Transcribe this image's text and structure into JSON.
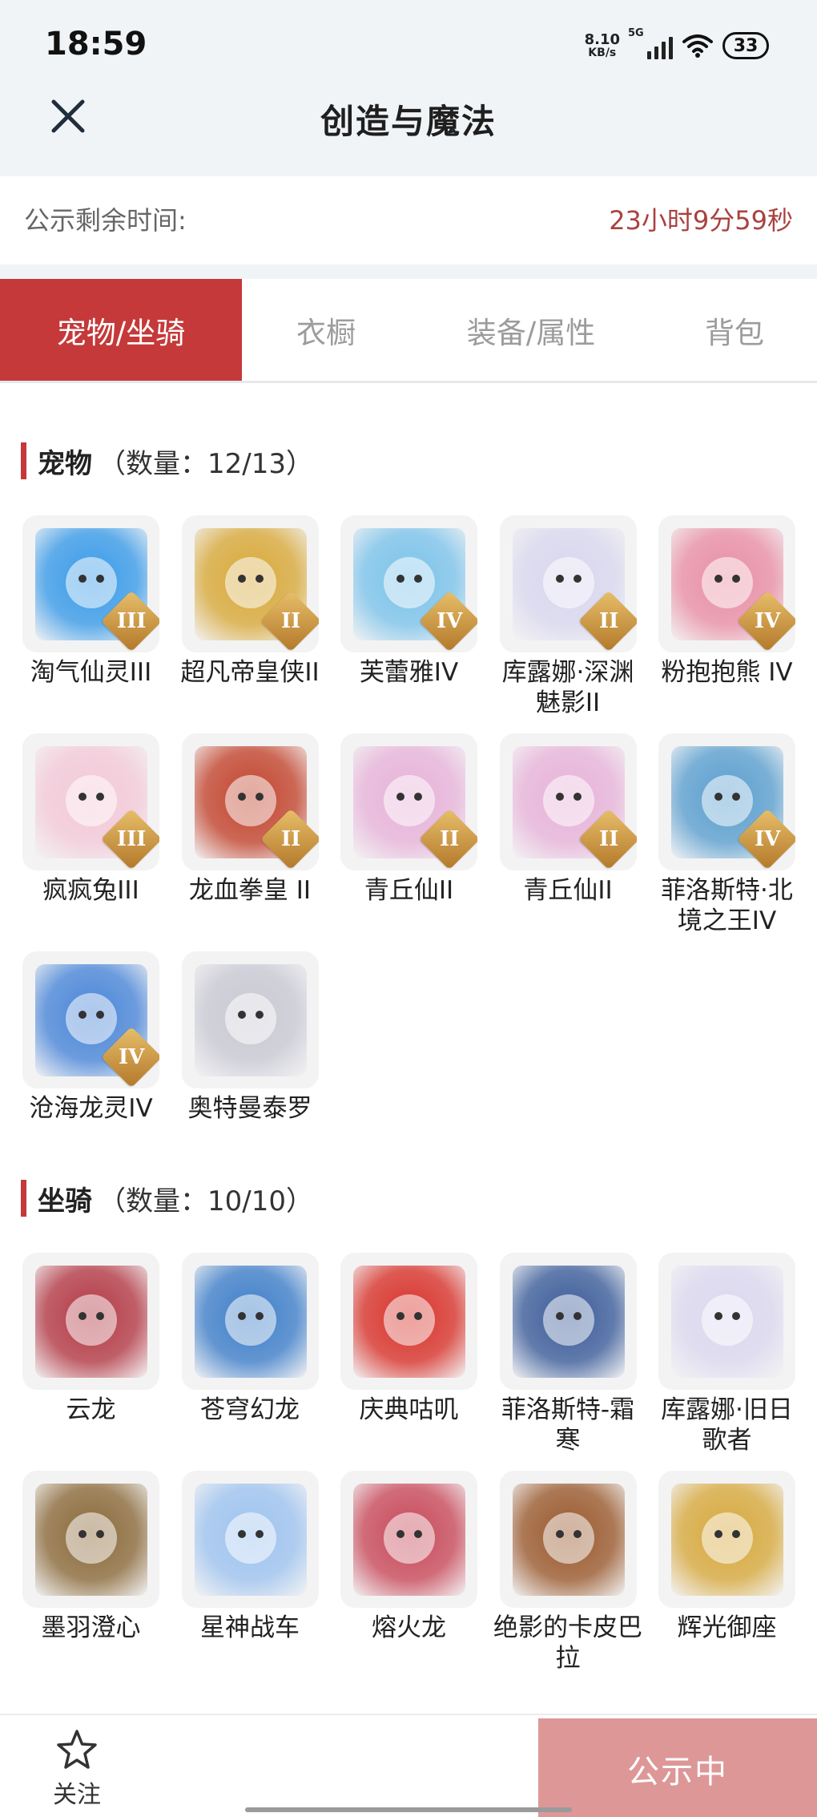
{
  "status_bar": {
    "time": "18:59",
    "net_speed_value": "8.10",
    "net_speed_unit": "KB/s",
    "network": "5G",
    "battery": "33"
  },
  "header": {
    "title": "创造与魔法"
  },
  "timer": {
    "label": "公示剩余时间:",
    "value": "23小时9分59秒"
  },
  "tabs": [
    {
      "label": "宠物/坐骑",
      "active": true
    },
    {
      "label": "衣橱",
      "active": false
    },
    {
      "label": "装备/属性",
      "active": false
    },
    {
      "label": "背包",
      "active": false
    }
  ],
  "pets": {
    "title": "宠物",
    "count": "（数量：12/13）",
    "items": [
      {
        "name": "淘气仙灵III",
        "tier": "III",
        "icon": "blue-dog-pet",
        "color": "#3a9be8"
      },
      {
        "name": "超凡帝皇侠II",
        "tier": "II",
        "icon": "gold-armor-hero",
        "color": "#d8a93a"
      },
      {
        "name": "芙蕾雅IV",
        "tier": "IV",
        "icon": "valkyrie-girl",
        "color": "#7cc3ea"
      },
      {
        "name": "库露娜·深渊魅影II",
        "tier": "II",
        "icon": "white-hair-girl",
        "color": "#d9d7ee"
      },
      {
        "name": "粉抱抱熊 IV",
        "tier": "IV",
        "icon": "pink-bear",
        "color": "#e98fa5"
      },
      {
        "name": "疯疯兔III",
        "tier": "III",
        "icon": "pink-rabbit",
        "color": "#f3c9d8"
      },
      {
        "name": "龙血拳皇 II",
        "tier": "II",
        "icon": "red-beast",
        "color": "#c2452e"
      },
      {
        "name": "青丘仙II",
        "tier": "II",
        "icon": "fox-girl",
        "color": "#e7b3d9"
      },
      {
        "name": "青丘仙II",
        "tier": "II",
        "icon": "fox-girl",
        "color": "#e7b3d9"
      },
      {
        "name": "菲洛斯特·北境之王IV",
        "tier": "IV",
        "icon": "ice-king",
        "color": "#5b9fcf"
      },
      {
        "name": "沧海龙灵IV",
        "tier": "IV",
        "icon": "sea-dragon-boy",
        "color": "#4a86d8"
      },
      {
        "name": "奥特曼泰罗",
        "tier": "",
        "icon": "ultraman-taro",
        "color": "#c9c9d4"
      }
    ]
  },
  "mounts": {
    "title": "坐骑",
    "count": "（数量：10/10）",
    "items": [
      {
        "name": "云龙",
        "icon": "cloud-dragon",
        "color": "#b33a45"
      },
      {
        "name": "苍穹幻龙",
        "icon": "sky-dragon",
        "color": "#3f7fc9"
      },
      {
        "name": "庆典咕叽",
        "icon": "festival-bird",
        "color": "#d8332b"
      },
      {
        "name": "菲洛斯特-霜寒",
        "icon": "frost-king",
        "color": "#3c5d9a"
      },
      {
        "name": "库露娜·旧日歌者",
        "icon": "white-hair-singer",
        "color": "#dcd8ef"
      },
      {
        "name": "墨羽澄心",
        "icon": "ink-feather-blade",
        "color": "#8b6a3a"
      },
      {
        "name": "星神战车",
        "icon": "star-chariot",
        "color": "#9ec3ef"
      },
      {
        "name": "熔火龙",
        "icon": "lava-dragon",
        "color": "#c84a5a"
      },
      {
        "name": "绝影的卡皮巴拉",
        "icon": "capybara",
        "color": "#9a5a2e"
      },
      {
        "name": "辉光御座",
        "icon": "radiant-throne",
        "color": "#d7a93e"
      }
    ]
  },
  "bottom": {
    "follow_label": "关注",
    "publish_label": "公示中"
  },
  "colors": {
    "accent": "#c5393a",
    "timer": "#a9423f",
    "publish_button": "#dd9797",
    "header_bg": "#f1f4f7"
  }
}
